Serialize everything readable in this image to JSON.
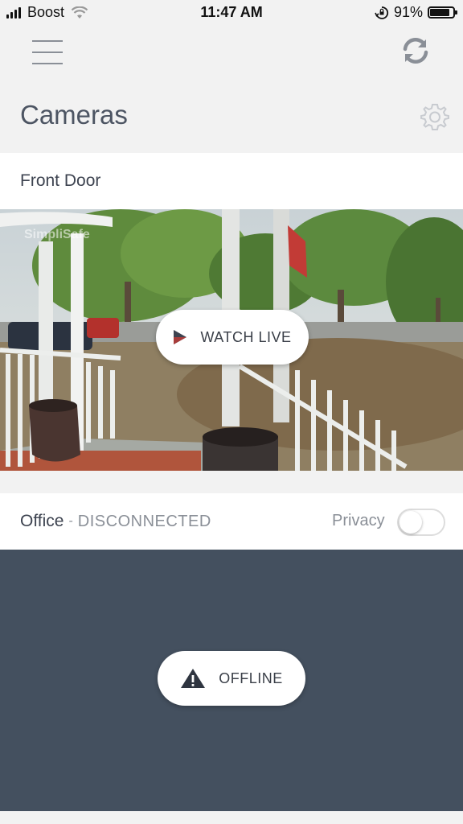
{
  "status_bar": {
    "carrier": "Boost",
    "time": "11:47 AM",
    "battery_percent": "91%",
    "battery_level": 0.91
  },
  "header": {
    "title": "Cameras"
  },
  "cameras": [
    {
      "name": "Front Door",
      "action_label": "WATCH LIVE",
      "watermark": "SimpliSafe"
    },
    {
      "name": "Office",
      "separator": "-",
      "status": "DISCONNECTED",
      "privacy_label": "Privacy",
      "privacy_on": false,
      "overlay_label": "OFFLINE"
    }
  ],
  "colors": {
    "offline_bg": "#44505f",
    "page_bg": "#f2f2f2",
    "text_dark": "#3d4350",
    "text_muted": "#8a8f97"
  },
  "icons": [
    "menu-icon",
    "refresh-icon",
    "gear-icon",
    "play-icon",
    "warning-icon",
    "wifi-icon",
    "orientation-lock-icon"
  ]
}
